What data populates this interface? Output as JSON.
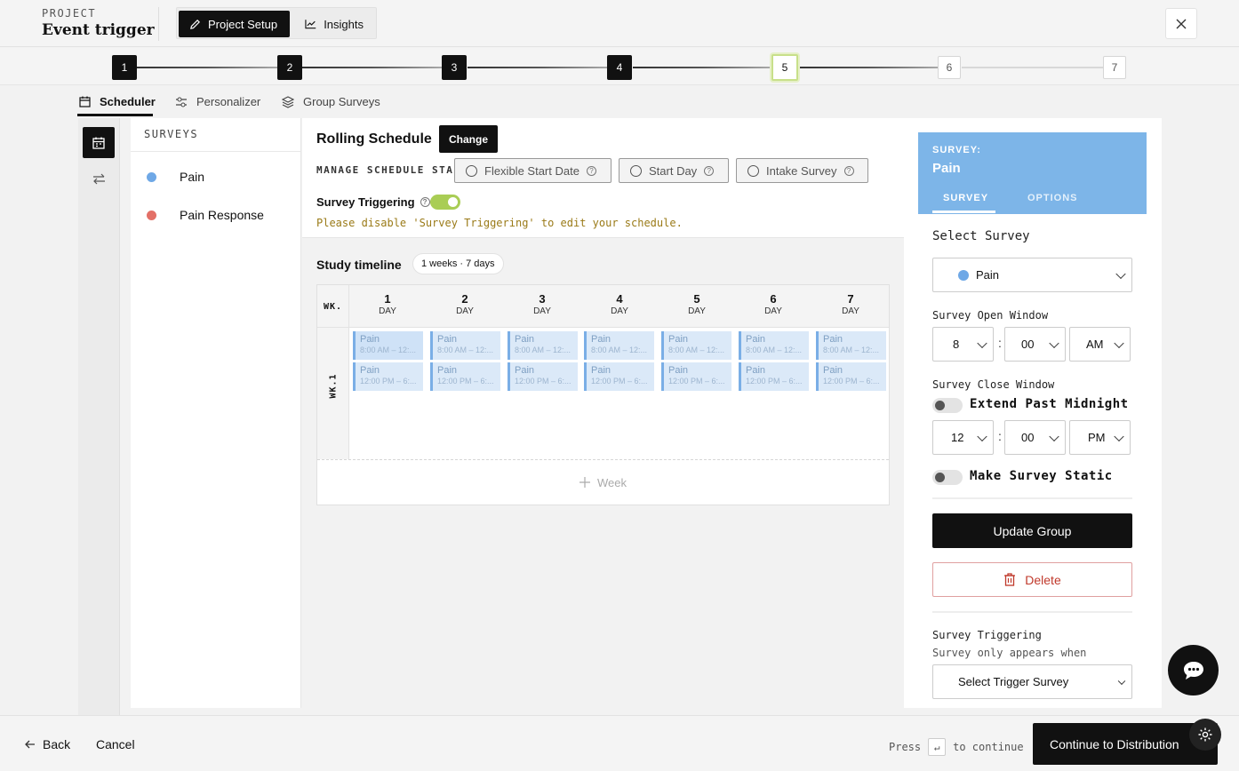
{
  "header": {
    "project_label": "PROJECT",
    "project_title": "Event trigger",
    "tabs": [
      {
        "label": "Project Setup",
        "icon": "pencil-icon"
      },
      {
        "label": "Insights",
        "icon": "chart-line-icon"
      }
    ]
  },
  "stepper": {
    "steps": [
      "1",
      "2",
      "3",
      "4",
      "5",
      "6",
      "7"
    ],
    "current_step": 5
  },
  "subtabs": [
    {
      "label": "Scheduler",
      "icon": "calendar-icon"
    },
    {
      "label": "Personalizer",
      "icon": "sliders-icon"
    },
    {
      "label": "Group Surveys",
      "icon": "layers-icon"
    }
  ],
  "surveys_panel": {
    "heading": "SURVEYS",
    "items": [
      {
        "label": "Pain",
        "color": "#6fa8e6"
      },
      {
        "label": "Pain Response",
        "color": "#e37067"
      }
    ]
  },
  "schedule": {
    "title": "Rolling Schedule",
    "change_label": "Change",
    "manage_start_label": "MANAGE SCHEDULE START",
    "start_options": [
      "Flexible Start Date",
      "Start Day",
      "Intake Survey"
    ],
    "triggering_label": "Survey Triggering",
    "triggering_on": true,
    "warning": "Please disable 'Survey Triggering' to edit your schedule."
  },
  "timeline": {
    "title": "Study timeline",
    "badge": "1 weeks · 7 days",
    "wk_header": "WK.",
    "week_label": "WK.1",
    "day_word": "DAY",
    "days": [
      "1",
      "2",
      "3",
      "4",
      "5",
      "6",
      "7"
    ],
    "slots": [
      {
        "name": "Pain",
        "time": "8:00 AM – 12:..."
      },
      {
        "name": "Pain",
        "time": "12:00 PM – 6:..."
      }
    ],
    "add_week_label": "Week"
  },
  "right_panel": {
    "survey_prefix": "SURVEY:",
    "survey_name": "Pain",
    "tabs": [
      "SURVEY",
      "OPTIONS"
    ],
    "select_survey_label": "Select Survey",
    "selected_survey": "Pain",
    "selected_survey_color": "#6fa8e6",
    "open_window_label": "Survey Open Window",
    "open_hour": "8",
    "open_minute": "00",
    "open_ampm": "AM",
    "close_window_label": "Survey Close Window",
    "extend_label": "Extend Past Midnight",
    "close_hour": "12",
    "close_minute": "00",
    "close_ampm": "PM",
    "static_label": "Make Survey Static",
    "update_label": "Update Group",
    "delete_label": "Delete",
    "triggering_label": "Survey Triggering",
    "triggering_sub": "Survey only appears when",
    "trigger_select_placeholder": "Select Trigger Survey",
    "colon": ":"
  },
  "footer": {
    "back_label": "Back",
    "cancel_label": "Cancel",
    "press_label": "Press",
    "enter_key": "↵",
    "to_continue": "to continue",
    "continue_label": "Continue to Distribution"
  }
}
